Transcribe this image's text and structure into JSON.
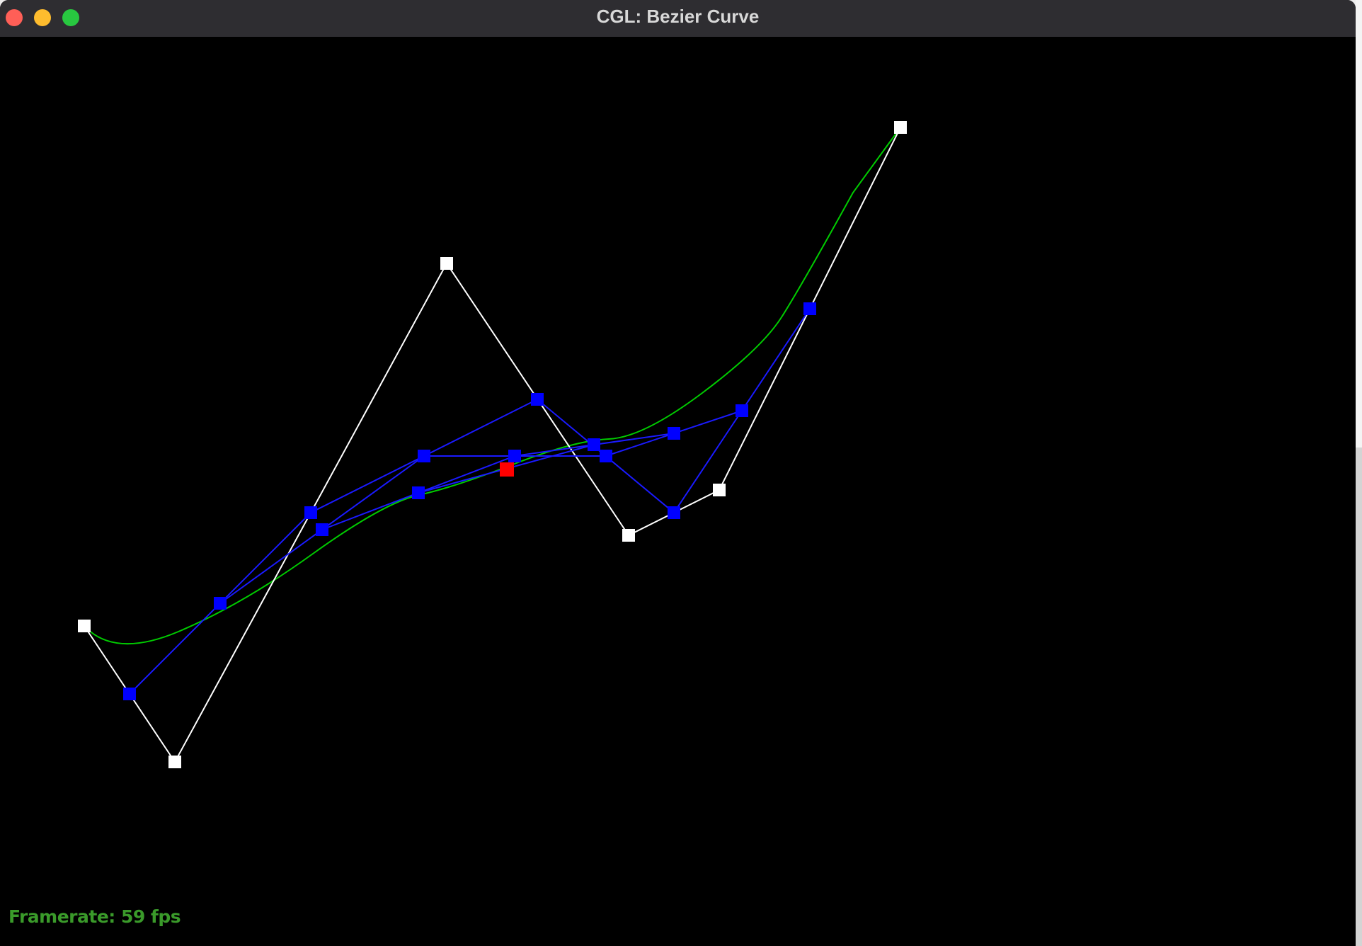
{
  "window": {
    "title": "CGL: Bezier Curve"
  },
  "status": {
    "framerate": "Framerate: 59 fps"
  },
  "colors": {
    "background": "#000000",
    "control_polygon": "#ffffff",
    "intermediate": "#0000ff",
    "curve": "#00cc00",
    "evaluated_point": "#ff0000",
    "framerate_text": "#3a9a2a"
  }
}
